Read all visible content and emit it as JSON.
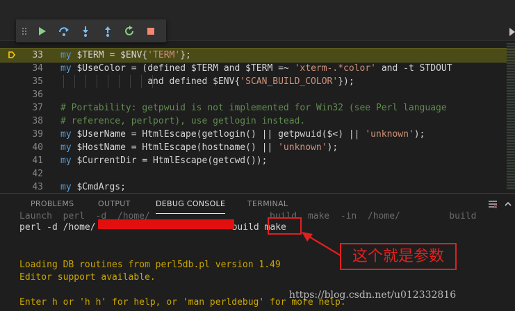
{
  "debug_toolbar": {
    "buttons": [
      {
        "icon": "continue-icon"
      },
      {
        "icon": "step-over-icon"
      },
      {
        "icon": "step-into-icon"
      },
      {
        "icon": "step-out-icon"
      },
      {
        "icon": "restart-icon"
      },
      {
        "icon": "stop-icon"
      }
    ],
    "colors": {
      "continue": "#89d185",
      "step": "#75beff",
      "restart": "#89d185",
      "stop": "#f48771"
    }
  },
  "editor": {
    "active_line": "33",
    "lines": [
      {
        "num": "33",
        "tokens": [
          {
            "t": "my ",
            "c": "kw"
          },
          {
            "t": "$TERM",
            "c": "var"
          },
          {
            "t": " = ",
            "c": "var"
          },
          {
            "t": "$ENV{",
            "c": "var"
          },
          {
            "t": "'TERM'",
            "c": "str"
          },
          {
            "t": "};",
            "c": "var"
          }
        ]
      },
      {
        "num": "34",
        "tokens": [
          {
            "t": "my ",
            "c": "kw"
          },
          {
            "t": "$UseColor",
            "c": "var"
          },
          {
            "t": " = (defined ",
            "c": "var"
          },
          {
            "t": "$TERM",
            "c": "var"
          },
          {
            "t": " and ",
            "c": "var"
          },
          {
            "t": "$TERM",
            "c": "var"
          },
          {
            "t": " =~ ",
            "c": "var"
          },
          {
            "t": "'xterm-.*color'",
            "c": "str"
          },
          {
            "t": " and -t STDOUT",
            "c": "var"
          }
        ]
      },
      {
        "num": "35",
        "tokens": [
          {
            "t": "                ",
            "c": "var"
          },
          {
            "t": "and defined ",
            "c": "var"
          },
          {
            "t": "$ENV{",
            "c": "var"
          },
          {
            "t": "'SCAN_BUILD_COLOR'",
            "c": "str"
          },
          {
            "t": "});",
            "c": "var"
          }
        ]
      },
      {
        "num": "36",
        "tokens": []
      },
      {
        "num": "37",
        "tokens": [
          {
            "t": "# Portability: getpwuid is not implemented for Win32 (see Perl language",
            "c": "cm"
          }
        ]
      },
      {
        "num": "38",
        "tokens": [
          {
            "t": "# reference, perlport), use getlogin instead.",
            "c": "cm"
          }
        ]
      },
      {
        "num": "39",
        "tokens": [
          {
            "t": "my ",
            "c": "kw"
          },
          {
            "t": "$UserName",
            "c": "var"
          },
          {
            "t": " = HtmlEscape(getlogin() || getpwuid(",
            "c": "var"
          },
          {
            "t": "$<",
            "c": "var"
          },
          {
            "t": ") || ",
            "c": "var"
          },
          {
            "t": "'unknown'",
            "c": "str"
          },
          {
            "t": ");",
            "c": "var"
          }
        ]
      },
      {
        "num": "40",
        "tokens": [
          {
            "t": "my ",
            "c": "kw"
          },
          {
            "t": "$HostName",
            "c": "var"
          },
          {
            "t": " = HtmlEscape(hostname() || ",
            "c": "var"
          },
          {
            "t": "'unknown'",
            "c": "str"
          },
          {
            "t": ");",
            "c": "var"
          }
        ]
      },
      {
        "num": "41",
        "tokens": [
          {
            "t": "my ",
            "c": "kw"
          },
          {
            "t": "$CurrentDir",
            "c": "var"
          },
          {
            "t": " = HtmlEscape(getcwd());",
            "c": "var"
          }
        ]
      },
      {
        "num": "42",
        "tokens": []
      },
      {
        "num": "43",
        "tokens": [
          {
            "t": "my ",
            "c": "kw"
          },
          {
            "t": "$CmdArgs",
            "c": "var"
          },
          {
            "t": ";",
            "c": "var"
          }
        ]
      }
    ]
  },
  "panel": {
    "tabs": [
      {
        "label": "PROBLEMS",
        "active": false
      },
      {
        "label": "OUTPUT",
        "active": false
      },
      {
        "label": "DEBUG CONSOLE",
        "active": true
      },
      {
        "label": "TERMINAL",
        "active": false
      }
    ]
  },
  "console": {
    "lines": [
      {
        "text": "Launch  perl  -d  /home/                      build  make  -in  /home/         build",
        "style": "cut"
      },
      {
        "text": "perl -d /home/",
        "style": "white"
      },
      {
        "text": "build make",
        "style": "white"
      },
      {
        "text": "Loading DB routines from perl5db.pl version 1.49",
        "style": "yellow"
      },
      {
        "text": "Editor support available.",
        "style": "yellow"
      },
      {
        "text": "Enter h or 'h h' for help, or 'man perldebug' for more help.",
        "style": "yellow"
      }
    ]
  },
  "annotation": {
    "callout_text": "这个就是参数",
    "color": "#e02020"
  },
  "watermark": "https://blog.csdn.net/u012332816"
}
